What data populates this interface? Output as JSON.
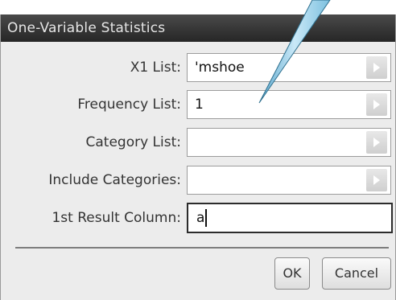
{
  "dialog": {
    "title": "One-Variable Statistics",
    "fields": [
      {
        "label": "X1 List:",
        "value": "'mshoe",
        "type": "dropdown"
      },
      {
        "label": "Frequency List:",
        "value": "1",
        "type": "dropdown"
      },
      {
        "label": "Category List:",
        "value": "",
        "type": "dropdown"
      },
      {
        "label": "Include Categories:",
        "value": "",
        "type": "dropdown"
      },
      {
        "label": "1st Result Column:",
        "value": "a",
        "type": "text"
      }
    ],
    "buttons": {
      "ok": "OK",
      "cancel": "Cancel"
    }
  }
}
